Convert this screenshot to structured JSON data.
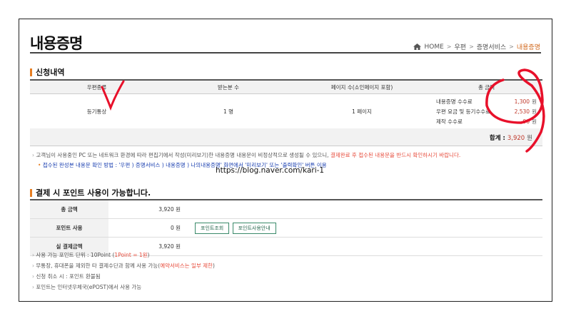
{
  "page": {
    "title": "내용증명",
    "breadcrumb": [
      "HOME",
      "우편",
      "증명서비스",
      "내용증명"
    ]
  },
  "application": {
    "section_title": "신청내역",
    "headers": [
      "우편종류",
      "받는분 수",
      "페이지 수(소인페이지 포함)",
      "총 금액"
    ],
    "row": {
      "mail_type": "등기통상",
      "recipients": "1 명",
      "pages": "1 페이지",
      "fees": [
        {
          "label": "내용증명 수수료",
          "value": "1,300",
          "unit": "원"
        },
        {
          "label": "우편 요금 및 등기수수료",
          "value": "2,530",
          "unit": "원"
        },
        {
          "label": "제작 수수료",
          "value": "90",
          "unit": "원"
        }
      ]
    },
    "total_label": "합계 :",
    "total_value": "3,920",
    "total_unit": "원"
  },
  "notes1": {
    "line1_prefix": "고객님이 사용중인 PC 또는 네트워크 환경에 따라 편집기에서 작성(미리보기)한 내용증명 내용문이 비정상적으로 생성될 수 있으니, ",
    "line1_red": "결제완료 후 접수된 내용문을 반드시 확인하시기 바랍니다.",
    "line2": "접수된 완성본 내용문 확인 방법 : '우편 ) 증명서비스 ) 내용증명 ) 나의내용증명' 화면에서 '미리보기' 또는 '출력확인' 버튼 이용"
  },
  "url_overlay": "https://blog.naver.com/kari-1",
  "points": {
    "section_title": "결제 시 포인트 사용이 가능합니다.",
    "rows": [
      {
        "label": "총 금액",
        "value": "3,920 원"
      },
      {
        "label": "포인트 사용",
        "value": "0 원"
      },
      {
        "label": "실 결제금액",
        "value": "3,920 원"
      }
    ],
    "btn_view": "포인트조회",
    "btn_guide": "포인트사용안내"
  },
  "notes2": {
    "l1_prefix": "사용 가능 포인트 단위 : 10Point (",
    "l1_red": "1Point = 1원",
    "l1_suffix": ")",
    "l2_prefix": "무통장, 휴대폰을 제외한 타 결제수단과 함께 사용 가능(",
    "l2_red": "예약서비스는 일부 제한",
    "l2_suffix": ")",
    "l3": "신청 취소 시 : 포인트 환불됨",
    "l4": "포인트는 인터넷우체국(ePOST)에서 사용 가능"
  },
  "colors": {
    "accent": "#e67e22",
    "price": "#c0392b",
    "annotation": "#e8102a",
    "link_blue": "#1a3fb0"
  }
}
